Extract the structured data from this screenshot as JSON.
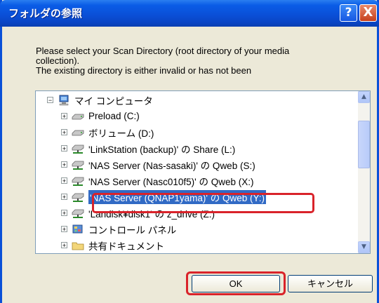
{
  "window": {
    "title": "フォルダの参照",
    "help_glyph": "?",
    "close_glyph": "X"
  },
  "instruction": {
    "line1": "Please select your Scan Directory (root directory of your media",
    "line2": "collection).",
    "line3": "The existing directory is either invalid or has not been"
  },
  "tree": {
    "root": {
      "label": "マイ コンピュータ",
      "expander": "−",
      "icon": "my-computer-icon"
    },
    "items": [
      {
        "label": "Preload (C:)",
        "expander": "+",
        "icon": "drive-icon",
        "selected": false
      },
      {
        "label": "ボリューム (D:)",
        "expander": "+",
        "icon": "drive-icon",
        "selected": false
      },
      {
        "label": "'LinkStation (backup)' の Share (L:)",
        "expander": "+",
        "icon": "network-drive-icon",
        "selected": false
      },
      {
        "label": "'NAS Server (Nas-sasaki)' の Qweb (S:)",
        "expander": "+",
        "icon": "network-drive-icon",
        "selected": false
      },
      {
        "label": "'NAS Server (Nasc010f5)' の Qweb (X:)",
        "expander": "+",
        "icon": "network-drive-icon",
        "selected": false
      },
      {
        "label": "'NAS Server (QNAP1yama)' の Qweb (Y:)",
        "expander": "+",
        "icon": "network-drive-icon",
        "selected": true
      },
      {
        "label": "'Landisk¥disk1' の z_drive (Z:)",
        "expander": "+",
        "icon": "network-drive-icon",
        "selected": false
      },
      {
        "label": "コントロール パネル",
        "expander": "+",
        "icon": "control-panel-icon",
        "selected": false
      },
      {
        "label": "共有ドキュメント",
        "expander": "+",
        "icon": "shared-folder-icon",
        "selected": false
      }
    ]
  },
  "scrollbar": {
    "up": "▲",
    "down": "▼"
  },
  "buttons": {
    "ok": "OK",
    "cancel": "キャンセル"
  },
  "colors": {
    "title_bar": "#0a50d8",
    "selection": "#316ac5",
    "highlight_box": "#d9232a",
    "dialog_bg": "#ece9d8"
  }
}
